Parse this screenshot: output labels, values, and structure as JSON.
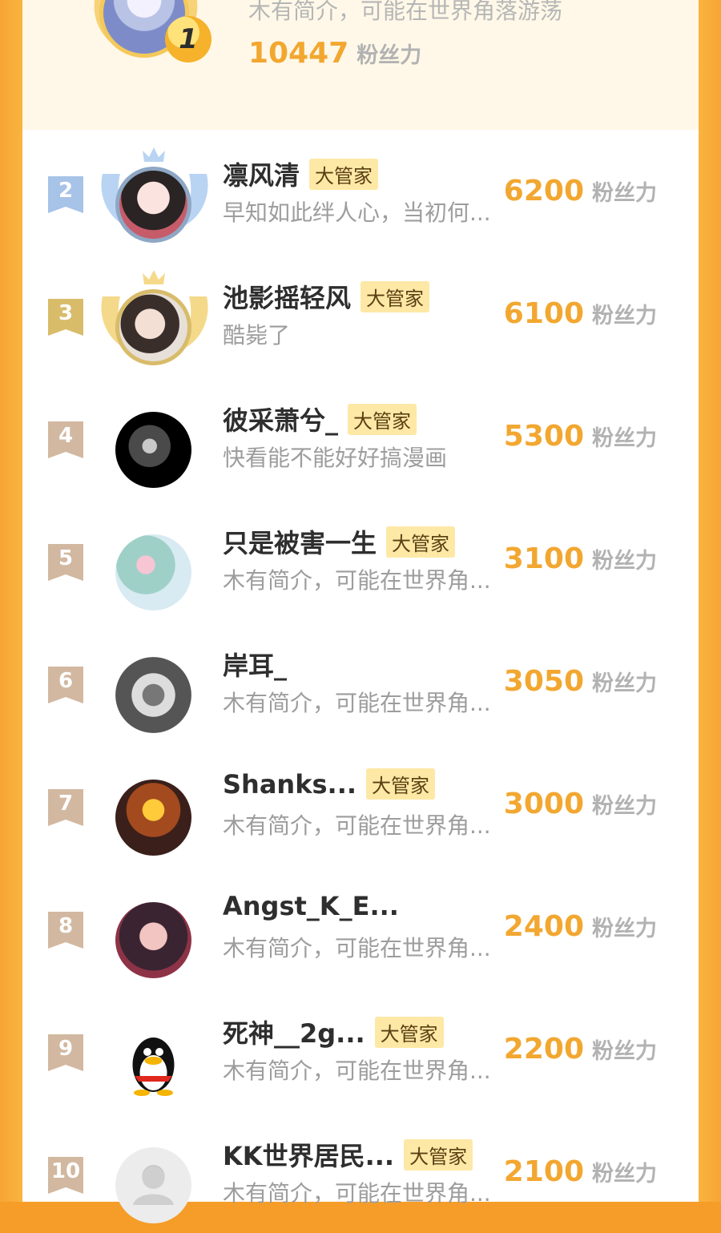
{
  "top": {
    "rank": "1",
    "description": "木有简介，可能在世界角落游荡",
    "score": "10447",
    "score_unit": "粉丝力"
  },
  "rows": [
    {
      "rank": "2",
      "name": "凛风清",
      "tag": "大管家",
      "description": "早知如此绊人心，当初何...",
      "score": "6200",
      "score_unit": "粉丝力",
      "badge_color": "#a7c3e7",
      "frame": "silver"
    },
    {
      "rank": "3",
      "name": "池影摇轻风",
      "tag": "大管家",
      "description": "酷毙了",
      "score": "6100",
      "score_unit": "粉丝力",
      "badge_color": "#d8bc6a",
      "frame": "gold"
    },
    {
      "rank": "4",
      "name": "彼采萧兮_",
      "tag": "大管家",
      "description": "快看能不能好好搞漫画",
      "score": "5300",
      "score_unit": "粉丝力",
      "badge_color": "#d2b8a0",
      "frame": "none"
    },
    {
      "rank": "5",
      "name": "只是被害一生",
      "tag": "大管家",
      "description": "木有简介，可能在世界角...",
      "score": "3100",
      "score_unit": "粉丝力",
      "badge_color": "#d2b8a0",
      "frame": "none"
    },
    {
      "rank": "6",
      "name": "岸耳_",
      "tag": "",
      "description": "木有简介，可能在世界角...",
      "score": "3050",
      "score_unit": "粉丝力",
      "badge_color": "#d2b8a0",
      "frame": "none"
    },
    {
      "rank": "7",
      "name": "Shanks...",
      "tag": "大管家",
      "description": "木有简介，可能在世界角...",
      "score": "3000",
      "score_unit": "粉丝力",
      "badge_color": "#d2b8a0",
      "frame": "none"
    },
    {
      "rank": "8",
      "name": "Angst_K_E...",
      "tag": "",
      "description": "木有简介，可能在世界角...",
      "score": "2400",
      "score_unit": "粉丝力",
      "badge_color": "#d2b8a0",
      "frame": "none"
    },
    {
      "rank": "9",
      "name": "死神__2g...",
      "tag": "大管家",
      "description": "木有简介，可能在世界角...",
      "score": "2200",
      "score_unit": "粉丝力",
      "badge_color": "#d2b8a0",
      "frame": "none"
    },
    {
      "rank": "10",
      "name": "KK世界居民...",
      "tag": "大管家",
      "description": "木有简介，可能在世界角...",
      "score": "2100",
      "score_unit": "粉丝力",
      "badge_color": "#d2b8a0",
      "frame": "none"
    }
  ]
}
